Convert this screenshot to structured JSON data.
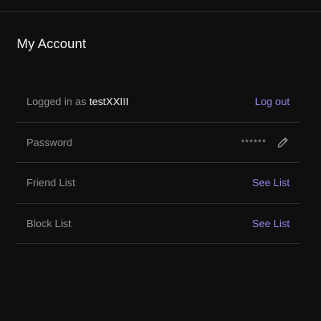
{
  "page": {
    "title": "My Account"
  },
  "account": {
    "logged_in_prefix": "Logged in as ",
    "username": "testXXIII",
    "logout_label": "Log out",
    "password_label": "Password",
    "password_mask": "******",
    "friend_list_label": "Friend List",
    "friend_list_action": "See List",
    "block_list_label": "Block List",
    "block_list_action": "See List"
  },
  "icons": {
    "edit": "pencil-icon"
  },
  "colors": {
    "background": "#0f0f0f",
    "accent": "#9b82e6",
    "divider": "#2e2e2e"
  }
}
